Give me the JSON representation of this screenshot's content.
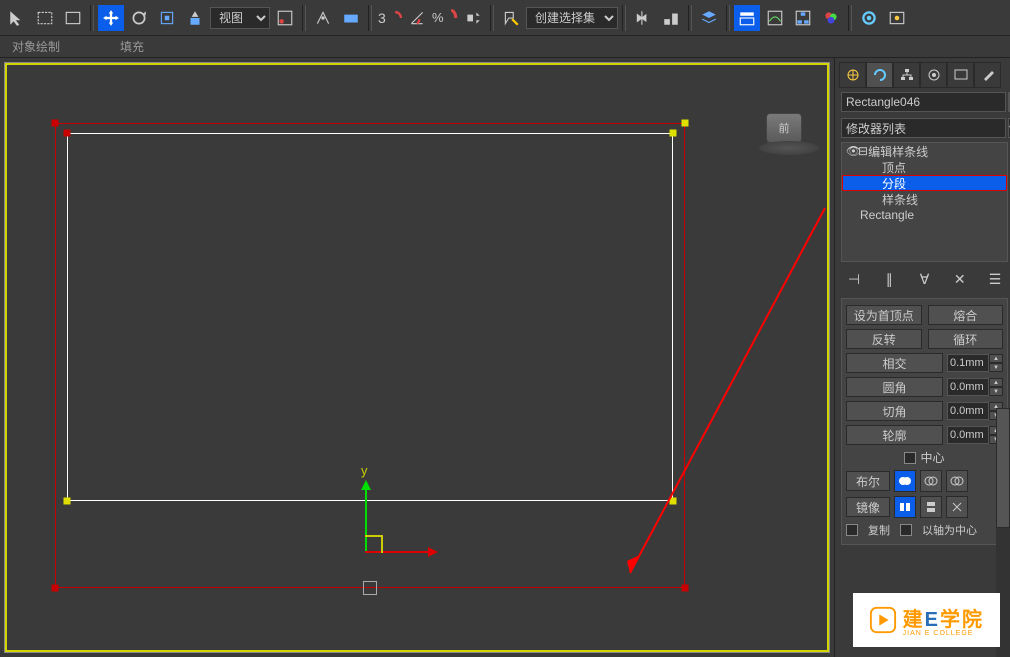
{
  "toolbar": {
    "view_select": "视图",
    "angle_val": "3",
    "create_set": "创建选择集"
  },
  "subbar": {
    "obj_draw": "对象绘制",
    "fill": "填充"
  },
  "viewport": {
    "cube_label": "前",
    "gizmo_y": "y"
  },
  "panel": {
    "obj_name": "Rectangle046",
    "modifier_list": "修改器列表",
    "stack": {
      "edit_spline": "编辑样条线",
      "vertex": "顶点",
      "segment": "分段",
      "spline": "样条线",
      "base": "Rectangle"
    },
    "geom": {
      "make_first": "设为首顶点",
      "fuse": "熔合",
      "reverse": "反转",
      "cycle": "循环",
      "cross": "相交",
      "cross_val": "0.1mm",
      "fillet": "圆角",
      "fillet_val": "0.0mm",
      "chamfer": "切角",
      "chamfer_val": "0.0mm",
      "outline": "轮廓",
      "outline_val": "0.0mm",
      "center": "中心",
      "bool": "布尔",
      "mirror": "镜像",
      "copy": "复制",
      "by_pivot": "以轴为中心"
    }
  },
  "watermark": {
    "title_a": "建",
    "title_b": "E",
    "title_c": "学院",
    "sub": "JIAN E COLLEGE"
  }
}
